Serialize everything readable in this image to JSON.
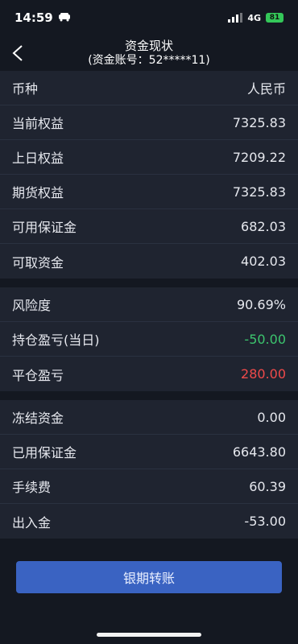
{
  "statusbar": {
    "time": "14:59",
    "network": "4G",
    "battery": "81"
  },
  "header": {
    "title": "资金现状",
    "subtitle": "(资金账号：52*****11)"
  },
  "sections": [
    {
      "rows": [
        {
          "label": "币种",
          "value": "人民币"
        },
        {
          "label": "当前权益",
          "value": "7325.83"
        },
        {
          "label": "上日权益",
          "value": "7209.22"
        },
        {
          "label": "期货权益",
          "value": "7325.83"
        },
        {
          "label": "可用保证金",
          "value": "682.03"
        },
        {
          "label": "可取资金",
          "value": "402.03"
        }
      ]
    },
    {
      "rows": [
        {
          "label": "风险度",
          "value": "90.69%"
        },
        {
          "label": "持仓盈亏(当日)",
          "value": "-50.00"
        },
        {
          "label": "平仓盈亏",
          "value": "280.00"
        }
      ]
    },
    {
      "rows": [
        {
          "label": "冻结资金",
          "value": "0.00"
        },
        {
          "label": "已用保证金",
          "value": "6643.80"
        },
        {
          "label": "手续费",
          "value": "60.39"
        },
        {
          "label": "出入金",
          "value": "-53.00"
        }
      ]
    }
  ],
  "button": {
    "label": "银期转账"
  },
  "colors": {
    "positive": "#3cc56e",
    "negative": "#f04a4a",
    "accent": "#3a63c2"
  }
}
